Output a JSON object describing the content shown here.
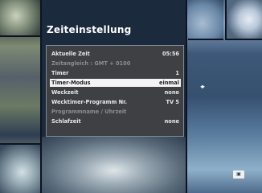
{
  "menu": {
    "title": "Zeiteinstellung",
    "items": [
      {
        "label": "Aktuelle Zeit",
        "value": "05:56",
        "state": "normal"
      },
      {
        "label": "Zeitangleich : GMT + 0100",
        "value": "",
        "state": "disabled"
      },
      {
        "label": "Timer",
        "value": "1",
        "state": "normal"
      },
      {
        "label": "Timer-Modus",
        "value": "einmal",
        "state": "selected"
      },
      {
        "label": "Weckzeit",
        "value": "none",
        "state": "normal"
      },
      {
        "label": "Wecktimer-Programm Nr.",
        "value": "TV 5",
        "state": "normal"
      },
      {
        "label": "Programmname / Uhrzeit",
        "value": "",
        "state": "disabled"
      },
      {
        "label": "Schlafzeit",
        "value": "none",
        "state": "normal"
      }
    ]
  },
  "indicators": {
    "navigation_arrows": "◂▸",
    "corner_badge": "▣"
  }
}
